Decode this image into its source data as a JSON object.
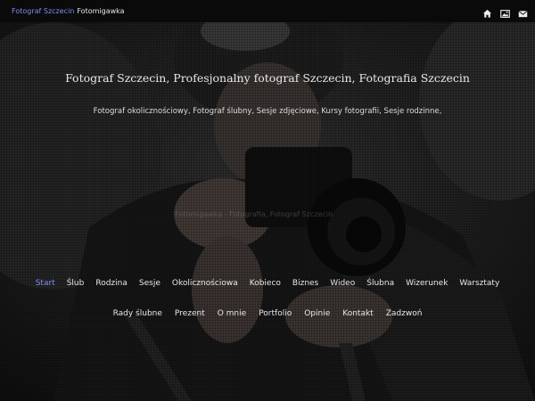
{
  "header": {
    "brand_link": "Fotograf Szczecin",
    "brand_sub": "Fotomigawka",
    "icons": [
      "home-icon",
      "image-icon",
      "envelope-icon"
    ]
  },
  "hero": {
    "title": "Fotograf Szczecin, Profesjonalny fotograf Szczecin, Fotografia Szczecin",
    "subtitle": "Fotograf okolicznościowy, Fotograf ślubny, Sesje zdjęciowe, Kursy fotografii, Sesje rodzinne,",
    "ghost_text": "Fotomigawka - Fotografia, Fotograf Szczecin"
  },
  "nav_row1": [
    "Start",
    "Ślub",
    "Rodzina",
    "Sesje",
    "Okolicznościowa",
    "Kobieco",
    "Biznes",
    "Wideo",
    "Ślubna",
    "Wizerunek",
    "Warsztaty"
  ],
  "nav_row2": [
    "Rady ślubne",
    "Prezent",
    "O mnie",
    "Portfolio",
    "Opinie",
    "Kontakt",
    "Zadzwoń"
  ],
  "colors": {
    "accent": "#7d8ff5",
    "bar": "#0a0a0a",
    "text": "#e8e8e8"
  }
}
